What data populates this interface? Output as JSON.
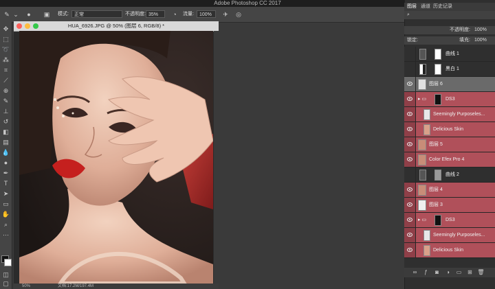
{
  "app": {
    "title": "Adobe Photoshop CC 2017"
  },
  "options": {
    "mode_label": "模式:",
    "mode_value": "正常",
    "opacity_label": "不透明度:",
    "opacity_value": "35%",
    "flow_label": "流量:",
    "flow_value": "100%"
  },
  "document": {
    "title": "HUA_6926.JPG @ 50% (图层 6, RGB/8) *",
    "zoom": "50%",
    "doc_info": "文档:17.2M/197.4M"
  },
  "panel": {
    "tabs": [
      "图层",
      "通道",
      "历史记录"
    ],
    "opacity_label": "不透明度:",
    "opacity_value": "100%",
    "lock_label": "锁定:",
    "fill_label": "填充:",
    "fill_value": "100%",
    "layers": [
      {
        "name": "曲线 1",
        "style": "normal",
        "visible": false,
        "thumb": "white"
      },
      {
        "name": "黑白 1",
        "style": "normal",
        "visible": false,
        "thumb": "white"
      },
      {
        "name": "图层 6",
        "style": "selected",
        "visible": true,
        "thumb": "white"
      },
      {
        "name": "DS3",
        "style": "red",
        "visible": true,
        "thumb": "black"
      },
      {
        "name": "Seemingly Purposeles...",
        "style": "red",
        "visible": true,
        "thumb": "white"
      },
      {
        "name": "Delicious Skin",
        "style": "red",
        "visible": true,
        "thumb": "photo"
      },
      {
        "name": "图层 5",
        "style": "red",
        "visible": true,
        "thumb": "photo"
      },
      {
        "name": "Color Efex Pro 4",
        "style": "red",
        "visible": true,
        "thumb": "photo"
      },
      {
        "name": "曲线 2",
        "style": "normal",
        "visible": false,
        "thumb": "white"
      },
      {
        "name": "图层 4",
        "style": "red",
        "visible": true,
        "thumb": "photo"
      },
      {
        "name": "图层 3",
        "style": "red",
        "visible": true,
        "thumb": "white"
      },
      {
        "name": "DS3",
        "style": "red",
        "visible": true,
        "thumb": "black"
      },
      {
        "name": "Seemingly Purposeles...",
        "style": "red",
        "visible": true,
        "thumb": "white"
      },
      {
        "name": "Delicious Skin",
        "style": "red",
        "visible": true,
        "thumb": "photo"
      }
    ]
  },
  "colors": {
    "layer_highlight": "#b0505a",
    "selected": "#6a6a6a"
  }
}
